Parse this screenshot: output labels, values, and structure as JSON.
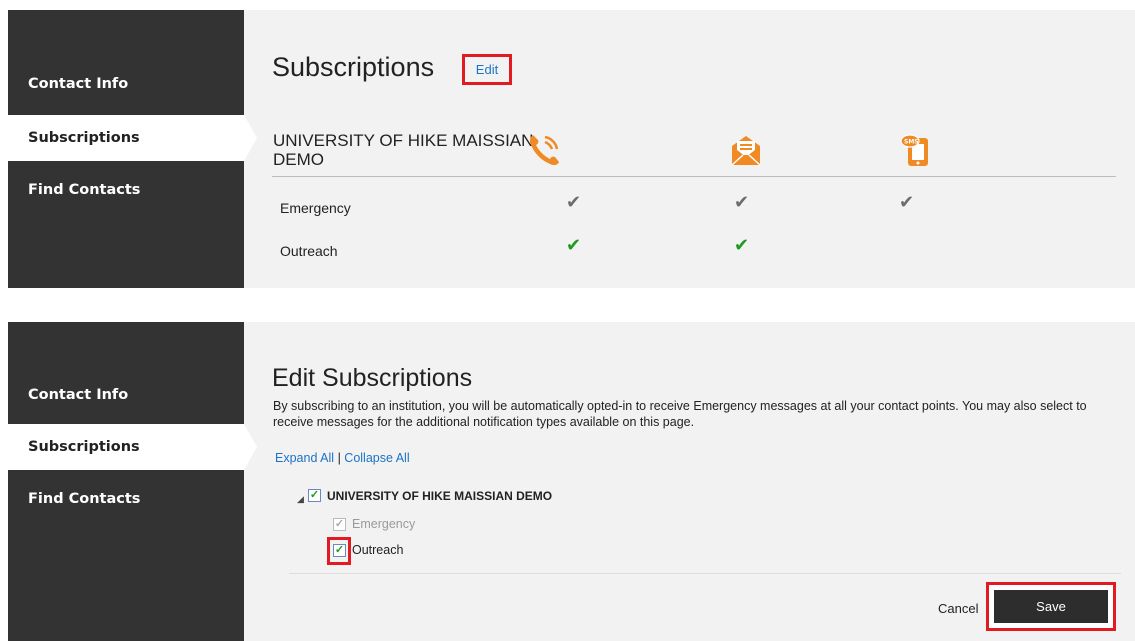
{
  "top_panel": {
    "sidebar": {
      "items": [
        {
          "label": "Contact Info",
          "active": false
        },
        {
          "label": "Subscriptions",
          "active": true
        },
        {
          "label": "Find Contacts",
          "active": false
        }
      ]
    },
    "title": "Subscriptions",
    "edit_label": "Edit",
    "institution": "UNIVERSITY OF HIKE MAISSIAN DEMO",
    "columns": [
      {
        "icon": "phone-icon",
        "color": "#f08a24"
      },
      {
        "icon": "email-icon",
        "color": "#f08a24"
      },
      {
        "icon": "sms-icon",
        "color": "#f08a24"
      }
    ],
    "rows": [
      {
        "label": "Emergency",
        "checks": [
          true,
          true,
          true
        ],
        "check_color": "#6d6d6d"
      },
      {
        "label": "Outreach",
        "checks": [
          true,
          true,
          false
        ],
        "check_color": "#1e9b1e"
      }
    ]
  },
  "bottom_panel": {
    "sidebar": {
      "items": [
        {
          "label": "Contact Info",
          "active": false
        },
        {
          "label": "Subscriptions",
          "active": true
        },
        {
          "label": "Find Contacts",
          "active": false
        }
      ]
    },
    "title": "Edit Subscriptions",
    "description": "By subscribing to an institution, you will be automatically opted-in to receive Emergency messages at all your contact points. You may also select to receive messages for the additional notification types available on this page.",
    "expand_all": "Expand All",
    "separator": "|",
    "collapse_all": "Collapse All",
    "tree": {
      "institution": "UNIVERSITY OF HIKE MAISSIAN DEMO",
      "institution_checked": true,
      "children": [
        {
          "label": "Emergency",
          "checked": true,
          "disabled": true
        },
        {
          "label": "Outreach",
          "checked": true,
          "disabled": false
        }
      ]
    },
    "cancel_label": "Cancel",
    "save_label": "Save"
  },
  "colors": {
    "sidebar_bg": "#333333",
    "panel_bg": "#f2f2f2",
    "accent_orange": "#f08a24",
    "link_blue": "#1a73c8",
    "highlight_red": "#e21b23",
    "check_green": "#1e9b1e"
  }
}
